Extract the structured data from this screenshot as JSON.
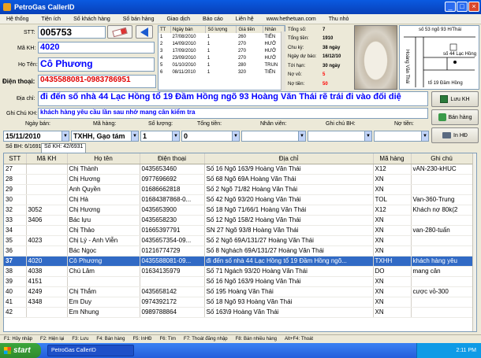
{
  "window": {
    "title": "PetroGas CallerID"
  },
  "menu": [
    "Hệ thống",
    "Tiện ích",
    "Số khách hàng",
    "Số bán hàng",
    "Giao dịch",
    "Báo cáo",
    "Liên hệ",
    "www.hethetuan.com",
    "Thu nhỏ"
  ],
  "form": {
    "stt_label": "STT:",
    "stt_value": "005753",
    "makh_label": "Mã KH:",
    "makh_value": "4020",
    "hoten_label": "Họ Tên:",
    "hoten_value": "Cô Phương",
    "dienthoai_label": "Điện thoại:",
    "dienthoai_value": "0435588081-0983786951",
    "diachi_label": "Địa chỉ:",
    "diachi_value": "đi đến số nhà 44 Lạc Hồng tổ 19 Đầm Hồng ngõ 93 Hoàng Văn Thái rẽ trái đi vào đối diệ",
    "ghichu_label": "Ghi Chú KH:",
    "ghichu_value": "khách hàng yêu cầu lần sau nhớ mang cân kiểm tra"
  },
  "mini_table": {
    "headers": [
      "TT",
      "Ngày bán",
      "Số lượng",
      "Giá tiền",
      "Nhân"
    ],
    "rows": [
      [
        "1",
        "27/08/2010",
        "1",
        "260",
        "TIẾN"
      ],
      [
        "2",
        "14/09/2010",
        "1",
        "270",
        "HƯỞ"
      ],
      [
        "3",
        "17/09/2010",
        "1",
        "270",
        "HƯỞ"
      ],
      [
        "4",
        "23/09/2010",
        "1",
        "270",
        "HƯỞ"
      ],
      [
        "5",
        "01/10/2010",
        "1",
        "280",
        "TRUN"
      ],
      [
        "6",
        "08/11/2010",
        "1",
        "320",
        "TIẾN"
      ]
    ]
  },
  "stats": [
    {
      "label": "Tổng số:",
      "value": "7",
      "color": "#000000"
    },
    {
      "label": "Tổng tiền:",
      "value": "1910",
      "color": "#000000"
    },
    {
      "label": "Chu kỳ:",
      "value": "38 ngày",
      "color": "#000000"
    },
    {
      "label": "Ngày dự báo:",
      "value": "16/12/10",
      "color": "#000000"
    },
    {
      "label": "Tới hạn:",
      "value": "30 ngày",
      "color": "#000000"
    },
    {
      "label": "Nợ vỏ:",
      "value": "5",
      "color": "#ff0000"
    },
    {
      "label": "Nợ tiền:",
      "value": "50",
      "color": "#ff0000"
    }
  ],
  "map": {
    "texts": [
      "số 53 ngõ 93 H/Thái",
      "số 44 Lạc Hồng",
      "Hoàng Văn Thái",
      "tổ 19 Đầm Hồng"
    ]
  },
  "actions": {
    "save": "Lưu KH",
    "sell": "Bán hàng",
    "print": "In HĐ"
  },
  "filters": {
    "labels": [
      "Ngày bán:",
      "Mã hàng:",
      "Số lượng:",
      "Tổng tiền:",
      "Nhân viên:",
      "Ghi chú BH:",
      "Nợ tiền:"
    ],
    "date": "15/11/2010",
    "product": "TXHH, Gạo tám",
    "qty": "1",
    "total": "0"
  },
  "tabs": [
    "Số BH: 6/1691",
    "Số KH: 42/6931"
  ],
  "table": {
    "headers": [
      "STT",
      "Mã KH",
      "Họ tên",
      "Điện thoại",
      "Địa chỉ",
      "Mã hàng",
      "Ghi chú"
    ],
    "rows": [
      [
        "27",
        "",
        "Chị Thành",
        "0435653460",
        "Số 16 Ngõ 163/9 Hoàng Văn Thái",
        "X12",
        "vAN-230-kHUC"
      ],
      [
        "28",
        "",
        "Chị Hương",
        "0977696692",
        "Số 68 Ngõ 69A Hoàng Văn Thái",
        "XN",
        ""
      ],
      [
        "29",
        "",
        "Anh Quyền",
        "01686662818",
        "Số 2 Ngõ 71/82 Hoàng Văn Thái",
        "XN",
        ""
      ],
      [
        "30",
        "",
        "Chị Hà",
        "01684387868-0...",
        "Số 42 Ngõ 93/20 Hoàng Văn Thái",
        "TOL",
        "Van-360-Trung"
      ],
      [
        "32",
        "3052",
        "Chị Hương",
        "0435653900",
        "Số 18 Ngõ 71/66/1 Hoàng Văn Thái",
        "X12",
        "Khách nợ 80k(2"
      ],
      [
        "33",
        "3406",
        "Bác lựu",
        "0435658230",
        "Số 12 Ngõ 158/2 Hoàng Văn Thái",
        "XN",
        ""
      ],
      [
        "34",
        "",
        "Chị Thảo",
        "01665397791",
        "SN 27 Ngõ 93/8 Hoàng Văn Thái",
        "XN",
        "van-280-tuấn"
      ],
      [
        "35",
        "4023",
        "Chị Lý - Anh Viễn",
        "0435657354-09...",
        "Số 2 Ngõ 69A/131/27 Hoàng Văn Thái",
        "XN",
        ""
      ],
      [
        "36",
        "",
        "Bác Ngọc",
        "01216774729",
        "Số 8 Nghách 69A/131/27 Hoàng Văn Thái",
        "XN",
        ""
      ],
      [
        "37",
        "4020",
        "Cô Phương",
        "0435588081-09...",
        "đi đến số nhà 44 Lạc Hồng tổ 19 Đầm Hồng ngõ...",
        "TXHH",
        "khách hàng yêu"
      ],
      [
        "38",
        "4038",
        "Chú Lâm",
        "01634135979",
        "Số 71 Ngách 93/20 Hoàng Văn Thái",
        "DO",
        "mang cân"
      ],
      [
        "39",
        "4151",
        "",
        "",
        "Số 16 Ngõ 163/9 Hoàng Văn Thái",
        "XN",
        ""
      ],
      [
        "40",
        "4249",
        "Chị Thắm",
        "0435658142",
        "Số 195 Hoàng Văn Thái",
        "XN",
        "cược vỏ-300"
      ],
      [
        "41",
        "4348",
        "Em Duy",
        "0974392172",
        "Số 18 Ngõ 93 Hoàng Văn Thái",
        "XN",
        ""
      ],
      [
        "42",
        "",
        "Em Nhung",
        "0989788864",
        "Số 163\\9 Hoàng Văn Thái",
        "XN",
        ""
      ]
    ],
    "selected_index": 9
  },
  "statusbar": [
    "F1: Hủy nhập",
    "F2: Hiện lại",
    "F3: Lưu",
    "F4: Bán hàng",
    "F5: InHĐ",
    "F6: Tìm",
    "F7: Thoát đăng nhập",
    "F8: Bán nhiều hàng",
    "Alt+F4: Thoát"
  ],
  "taskbar": {
    "start": "start",
    "task": "PetroGas CallerID",
    "clock": "2:11 PM"
  }
}
